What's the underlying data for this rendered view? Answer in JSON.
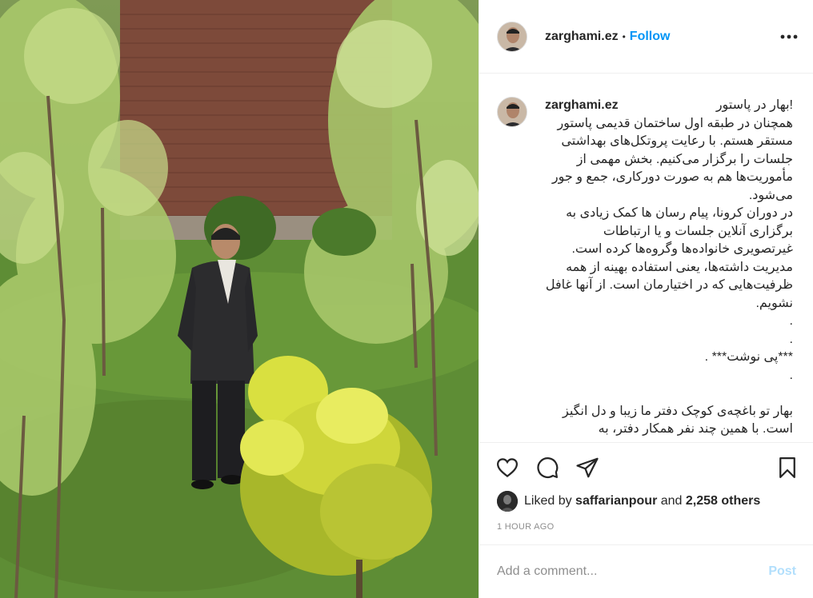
{
  "post": {
    "username": "zarghami.ez",
    "separator": "•",
    "follow_label": "Follow",
    "more_icon": "more-horizontal-icon"
  },
  "caption": {
    "username": "zarghami.ez",
    "text": "!بهار در پاستور\nهمچنان در طبقه اول ساختمان قدیمی پاستور مستقر هستم. با رعایت پروتکل‌های بهداشتی جلسات را برگزار می‌کنیم. بخش مهمی از مأموریت‌ها هم به صورت دورکاری، جمع و جور می‌شود.\nدر دوران کرونا، پیام رسان ها کمک زیادی به برگزاری آنلاین جلسات و یا ارتباطات غیرتصویری خانواده‌ها وگروه‌ها کرده است. مدیریت داشته‌ها، یعنی استفاده بهینه از همه ظرفیت‌هایی که در اختیارمان است. از آنها غافل نشویم.\n.\n.\n***پی نوشت*** .\n.\n\nبهار تو باغچه‌ی کوچک دفتر ما زیبا و دل انگیز است. با همین چند نفر همکار دفتر، به"
  },
  "actions": {
    "like_icon": "heart-icon",
    "comment_icon": "comment-icon",
    "share_icon": "paper-plane-icon",
    "save_icon": "bookmark-icon"
  },
  "likes": {
    "prefix": "Liked by",
    "user": "saffarianpour",
    "conjunction": "and",
    "count": "2,258 others"
  },
  "timestamp": "1 HOUR AGO",
  "comment_box": {
    "placeholder": "Add a comment...",
    "post_label": "Post"
  },
  "colors": {
    "accent": "#0095f6",
    "post_disabled": "#b2dffc",
    "muted": "#8e8e8e",
    "border": "#efefef"
  }
}
